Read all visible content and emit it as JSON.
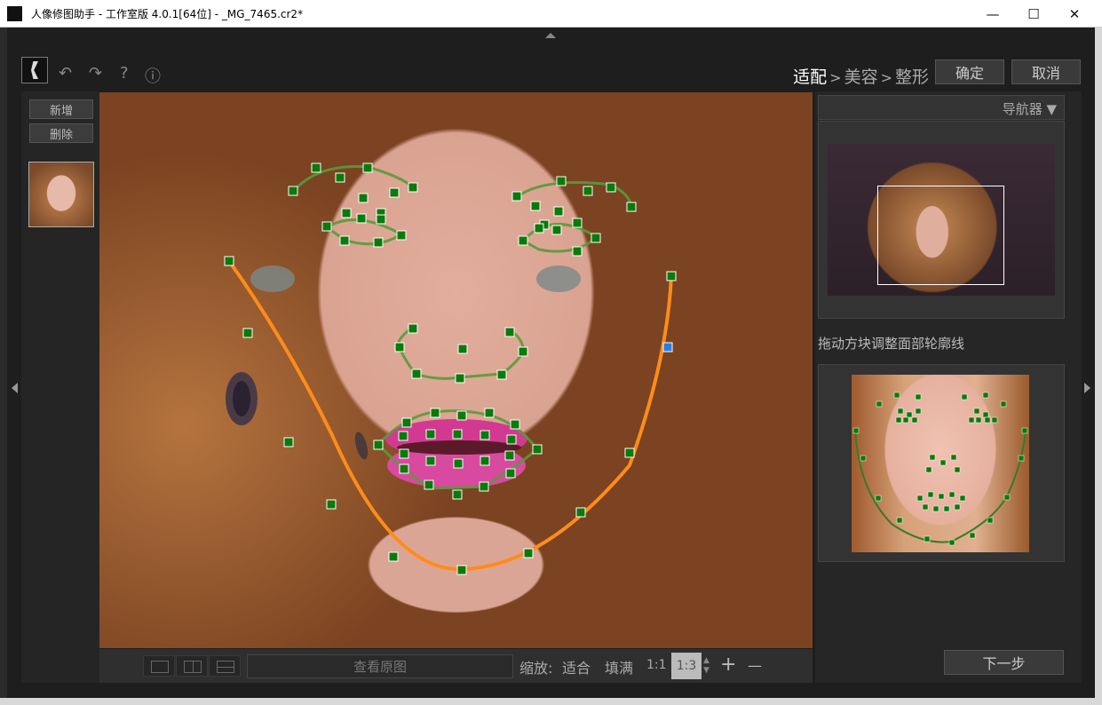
{
  "window": {
    "title": "人像修图助手 - 工作室版 4.0.1[64位] - _MG_7465.cr2*",
    "minimize": "—",
    "maximize": "☐",
    "close": "✕"
  },
  "toolbar": {
    "undo_icon": "↶",
    "redo_icon": "↷",
    "help_icon": "?",
    "info_icon": "ⓘ"
  },
  "steps": {
    "step1": "适配",
    "sep1": ">",
    "step2": "美容",
    "sep2": ">",
    "step3": "整形"
  },
  "buttons": {
    "confirm": "确定",
    "cancel": "取消",
    "add": "新增",
    "delete": "删除",
    "show_original": "查看原图",
    "next": "下一步"
  },
  "zoom": {
    "label": "缩放:",
    "fit": "适合",
    "fill": "填满",
    "one_to_one": "1:1",
    "current": "1:3",
    "plus": "+",
    "minus": "—"
  },
  "navigator": {
    "title": "导航器 ▼"
  },
  "hint": "拖动方块调整面部轮廓线",
  "colors": {
    "jaw_line": "#ff8c1a",
    "feature_line": "#5a9a3a",
    "handle": "#0a7a0a",
    "selected_handle": "#2b7de0"
  }
}
